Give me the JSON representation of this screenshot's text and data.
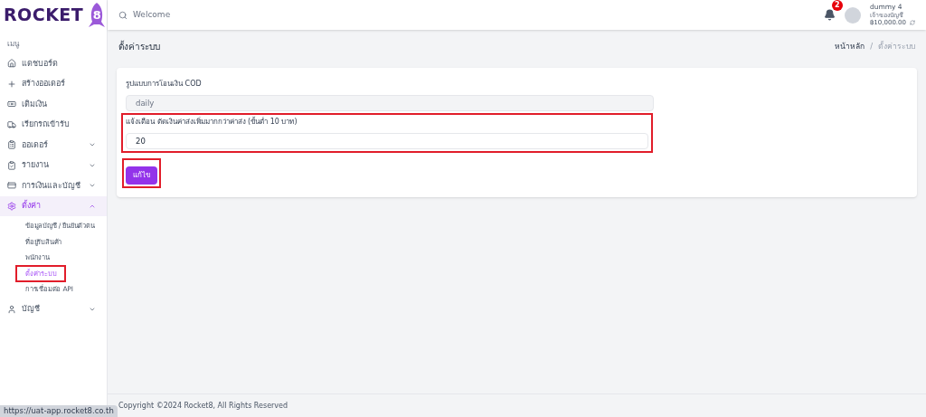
{
  "brand": {
    "word": "ROCKET",
    "digit": "8"
  },
  "search": {
    "placeholder": "Welcome"
  },
  "notifications": {
    "count": "2"
  },
  "user": {
    "name": "dummy 4",
    "role": "เจ้าของบัญชี",
    "balance": "฿10,000.00"
  },
  "sidebar": {
    "heading": "เมนู",
    "items": [
      {
        "label": "แดชบอร์ด",
        "kind": "link",
        "active": false
      },
      {
        "label": "สร้างออเดอร์",
        "kind": "link",
        "active": false
      },
      {
        "label": "เติมเงิน",
        "kind": "link",
        "active": false
      },
      {
        "label": "เรียกรถเข้ารับ",
        "kind": "link",
        "active": false
      },
      {
        "label": "ออเดอร์",
        "kind": "group",
        "expanded": false,
        "active": false
      },
      {
        "label": "รายงาน",
        "kind": "group",
        "expanded": false,
        "active": false
      },
      {
        "label": "การเงินและบัญชี",
        "kind": "group",
        "expanded": false,
        "active": false
      },
      {
        "label": "ตั้งค่า",
        "kind": "group",
        "expanded": true,
        "active": true,
        "children": [
          {
            "label": "ข้อมูลบัญชี / ยืนยันตัวตน",
            "selected": false,
            "highlighted": false
          },
          {
            "label": "ที่อยู่รับสินค้า",
            "selected": false,
            "highlighted": false
          },
          {
            "label": "พนักงาน",
            "selected": false,
            "highlighted": false
          },
          {
            "label": "ตั้งค่าระบบ",
            "selected": true,
            "highlighted": true
          },
          {
            "label": "การเชื่อมต่อ API",
            "selected": false,
            "highlighted": false
          }
        ]
      },
      {
        "label": "บัญชี",
        "kind": "group",
        "expanded": false,
        "active": false
      }
    ]
  },
  "page": {
    "title": "ตั้งค่าระบบ",
    "breadcrumb_separator": "/",
    "breadcrumb": [
      {
        "label": "หน้าหลัก",
        "current": false
      },
      {
        "label": "ตั้งค่าระบบ",
        "current": true
      }
    ]
  },
  "form": {
    "fields": [
      {
        "label": "รูปแบบการโอนเงิน COD",
        "value": "daily",
        "disabled": true,
        "highlighted": false
      },
      {
        "label": "แจ้งเตือน ตัดเงินค่าส่งเพิ่มมากกว่าค่าส่ง (ขั้นต่ำ 10 บาท)",
        "value": "20",
        "disabled": false,
        "highlighted": true
      }
    ],
    "button": {
      "label": "แก้ไข",
      "highlighted": true
    }
  },
  "footer": "Copyright ©2024 Rocket8, All Rights Reserved",
  "status_bar": "https://uat-app.rocket8.co.th"
}
